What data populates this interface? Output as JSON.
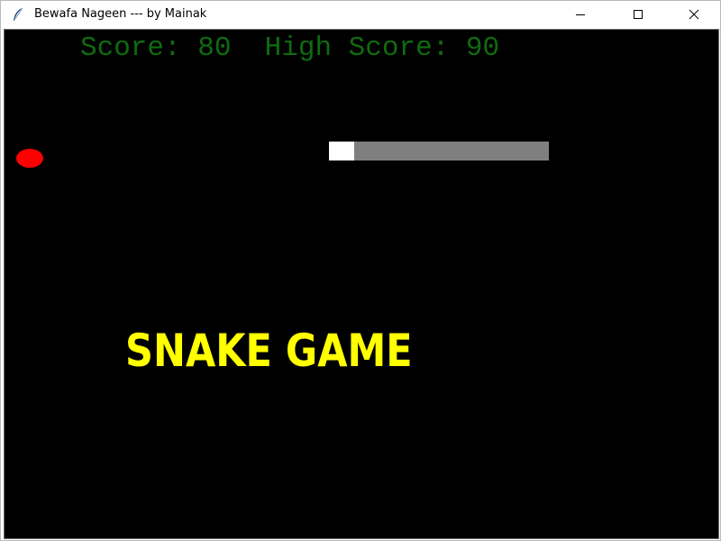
{
  "window": {
    "title": "Bewafa Nageen --- by Mainak",
    "icon": "feather-icon",
    "controls": [
      "minimize-icon",
      "maximize-icon",
      "close-icon"
    ]
  },
  "game": {
    "score_label": "Score:",
    "score": "80",
    "high_score_label": "High Score:",
    "high_score": "90",
    "title": "SNAKE GAME",
    "colors": {
      "background": "#000000",
      "score_text": "#0f6b0f",
      "food": "#ff0000",
      "snake_head": "#ffffff",
      "snake_body": "#7f7f7f",
      "title": "#ffff00"
    }
  }
}
